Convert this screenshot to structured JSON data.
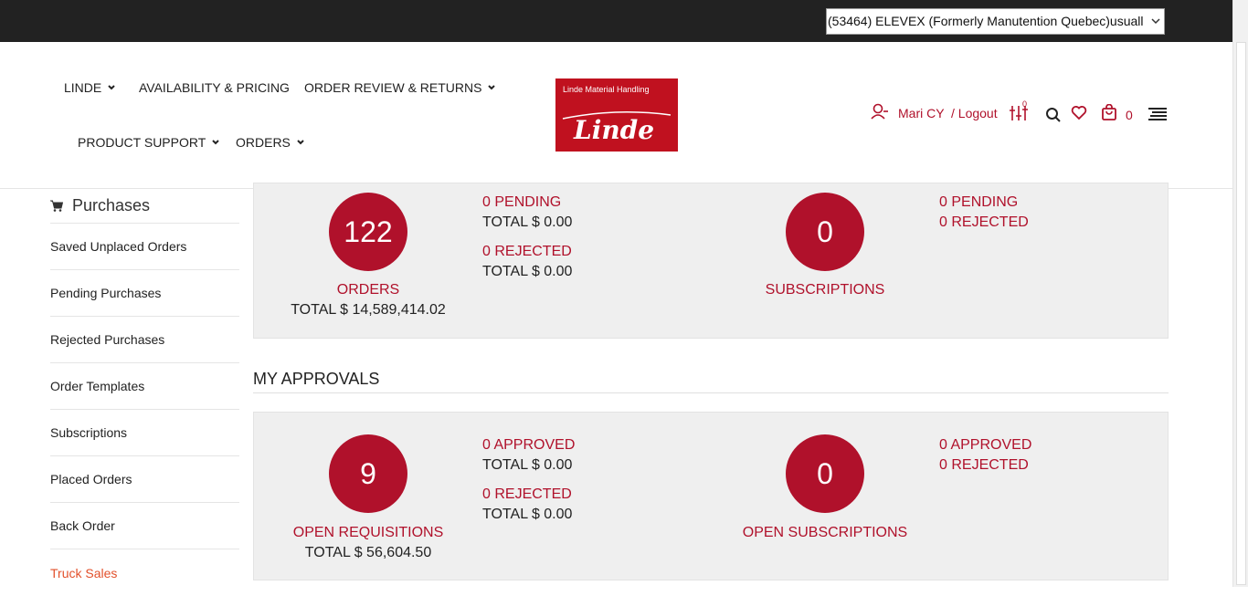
{
  "account_selector": {
    "value": "(53464) ELEVEX (Formerly Manutention Quebec)usuall"
  },
  "nav": {
    "linde": "LINDE",
    "availability": "AVAILABILITY & PRICING",
    "order_review": "ORDER REVIEW & RETURNS",
    "product_support": "PRODUCT SUPPORT",
    "orders": "ORDERS"
  },
  "logo": {
    "tagline": "Linde Material Handling",
    "wordmark": "Linde"
  },
  "user": {
    "name": "Mari CY",
    "logout": "/ Logout",
    "compare_count": "0",
    "cart_count": "0"
  },
  "sidebar": {
    "title": "Purchases",
    "items": [
      "Saved Unplaced Orders",
      "Pending Purchases",
      "Rejected Purchases",
      "Order Templates",
      "Subscriptions",
      "Placed Orders",
      "Back Order",
      "Truck Sales"
    ]
  },
  "purchases_panel": {
    "orders": {
      "count": "122",
      "label": "ORDERS",
      "total": "TOTAL $ 14,589,414.02",
      "pending": "0 PENDING",
      "pending_total": "TOTAL $ 0.00",
      "rejected": "0 REJECTED",
      "rejected_total": "TOTAL $ 0.00"
    },
    "subscriptions": {
      "count": "0",
      "label": "SUBSCRIPTIONS",
      "pending": "0 PENDING",
      "rejected": "0 REJECTED"
    }
  },
  "approvals": {
    "title": "MY APPROVALS",
    "requisitions": {
      "count": "9",
      "label": "OPEN REQUISITIONS",
      "total": "TOTAL $ 56,604.50",
      "approved": "0 APPROVED",
      "approved_total": "TOTAL $ 0.00",
      "rejected": "0 REJECTED",
      "rejected_total": "TOTAL $ 0.00"
    },
    "subscriptions": {
      "count": "0",
      "label": "OPEN SUBSCRIPTIONS",
      "approved": "0 APPROVED",
      "rejected": "0 REJECTED"
    }
  },
  "colors": {
    "brand_red": "#b0112b",
    "logo_red": "#c0111f",
    "active_link": "#e2502b",
    "topbar": "#222222",
    "panel_bg": "#efefef"
  }
}
